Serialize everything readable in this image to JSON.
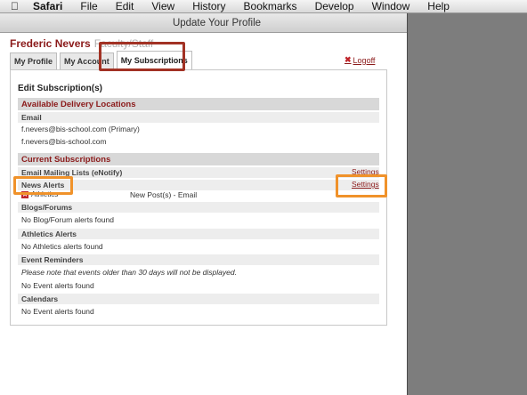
{
  "menubar": {
    "items": [
      "Safari",
      "File",
      "Edit",
      "View",
      "History",
      "Bookmarks",
      "Develop",
      "Window",
      "Help"
    ]
  },
  "window": {
    "title": "Update Your Profile"
  },
  "user": {
    "name": "Frederic Nevers",
    "role": "Faculty/Staff"
  },
  "tabs": [
    {
      "label": "My Profile",
      "active": false
    },
    {
      "label": "My Account",
      "active": false
    },
    {
      "label": "My Subscriptions",
      "active": true
    }
  ],
  "logoff": {
    "label": "Logoff"
  },
  "panel": {
    "title": "Edit Subscription(s)",
    "delivery": {
      "heading": "Available Delivery Locations",
      "email_label": "Email",
      "emails": [
        "f.nevers@bis-school.com  (Primary)",
        "f.nevers@bis-school.com"
      ]
    },
    "subscriptions": {
      "heading": "Current Subscriptions",
      "mailing_lists": {
        "label": "Email Mailing Lists (eNotify)",
        "settings": "Settings"
      },
      "news": {
        "label": "News Alerts",
        "settings": "Settings",
        "item_name": "Athletics",
        "item_detail": "New Post(s) - Email"
      },
      "blogs": {
        "label": "Blogs/Forums",
        "empty": "No Blog/Forum alerts found"
      },
      "athletics": {
        "label": "Athletics Alerts",
        "empty": "No Athletics alerts found"
      },
      "events": {
        "label": "Event Reminders",
        "note": "Please note that events older than 30 days will not be displayed.",
        "empty": "No Event alerts found"
      },
      "calendars": {
        "label": "Calendars",
        "empty": "No Event alerts found"
      }
    }
  },
  "colors": {
    "accent": "#8b1a1a",
    "highlight_red": "#a23224",
    "highlight_orange": "#f0922a"
  }
}
